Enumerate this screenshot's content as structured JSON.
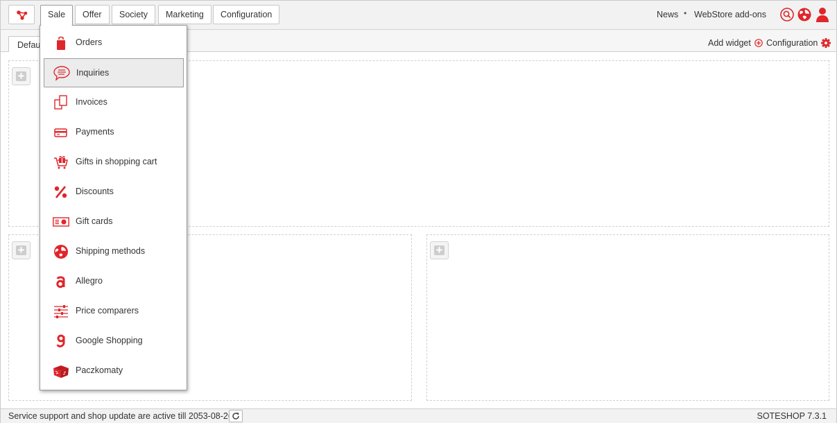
{
  "colors": {
    "accent": "#e0262b",
    "topbar": "#f2f2f2"
  },
  "nav": {
    "logo_icon": "soteshop-logo-icon",
    "tabs": [
      "Sale",
      "Offer",
      "Society",
      "Marketing",
      "Configuration"
    ],
    "active_tab": "Sale",
    "right_links": {
      "news": "News",
      "separator": "•",
      "addons": "WebStore add-ons"
    },
    "icons": [
      "search-icon",
      "globe-icon",
      "user-icon"
    ]
  },
  "dashboard": {
    "tab_label": "Default",
    "add_widget": "Add widget",
    "configuration": "Configuration"
  },
  "sale_menu": [
    {
      "label": "Orders",
      "icon": "shopping-bag-icon"
    },
    {
      "label": "Inquiries",
      "icon": "speech-bubble-icon"
    },
    {
      "label": "Invoices",
      "icon": "documents-icon"
    },
    {
      "label": "Payments",
      "icon": "credit-card-icon"
    },
    {
      "label": "Gifts in shopping cart",
      "icon": "gift-cart-icon"
    },
    {
      "label": "Discounts",
      "icon": "percent-icon"
    },
    {
      "label": "Gift cards",
      "icon": "gift-card-icon"
    },
    {
      "label": "Shipping methods",
      "icon": "globe-shipping-icon"
    },
    {
      "label": "Allegro",
      "icon": "allegro-icon"
    },
    {
      "label": "Price comparers",
      "icon": "sliders-icon"
    },
    {
      "label": "Google Shopping",
      "icon": "google-shopping-icon"
    },
    {
      "label": "Paczkomaty",
      "icon": "parcel-locker-icon"
    }
  ],
  "hovered_menu_item": "Inquiries",
  "status": {
    "text": "Service support and shop update are active till 2053-08-26",
    "version": "SOTESHOP 7.3.1"
  }
}
